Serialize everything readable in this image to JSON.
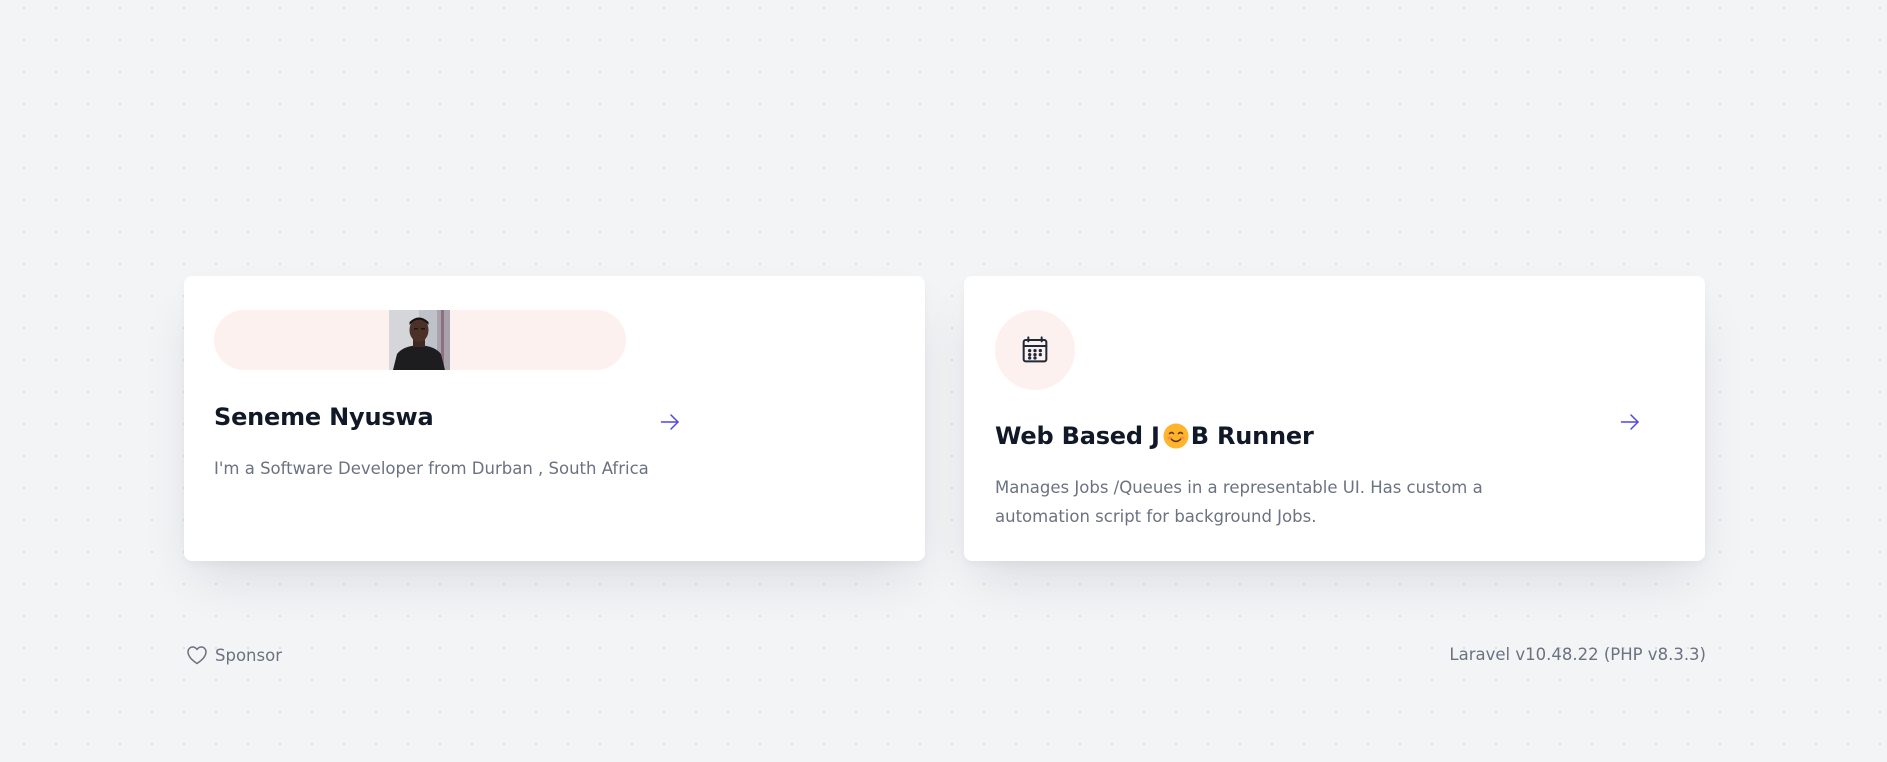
{
  "cards": [
    {
      "title": "Seneme Nyuswa",
      "description": "I'm a Software Developer from Durban , South Africa",
      "media": "profile-photo",
      "action_icon": "arrow-right-icon"
    },
    {
      "title_before_emoji": "Web Based J",
      "title_emoji": "smiling-face-emoji",
      "title_after_emoji": "B Runner",
      "description": "Manages Jobs /Queues in a representable UI. Has custom a automation script for background Jobs.",
      "media": "calendar-icon",
      "action_icon": "arrow-right-icon"
    }
  ],
  "footer": {
    "sponsor_label": "Sponsor",
    "sponsor_icon": "heart-icon",
    "version_text": "Laravel v10.48.22 (PHP v8.3.3)"
  },
  "colors": {
    "background": "#f3f4f6",
    "card": "#ffffff",
    "icon_bg": "#fdf1f0",
    "title": "#111827",
    "muted_text": "#6b7280",
    "accent": "#4f46e5"
  }
}
